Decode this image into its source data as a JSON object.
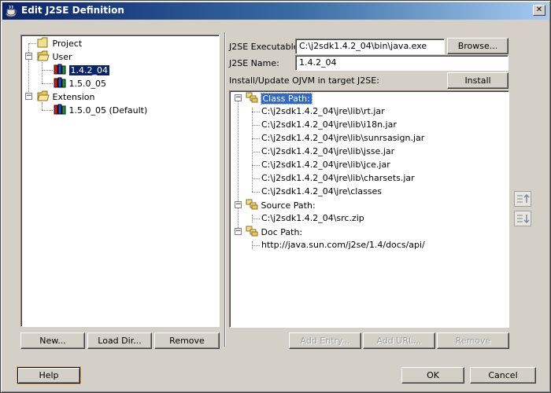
{
  "window": {
    "title": "Edit J2SE Definition",
    "close_glyph": "✕",
    "accent": "#0a246a"
  },
  "left_tree": {
    "nodes": [
      {
        "label": "Project",
        "icon": "folder-icon"
      },
      {
        "label": "User",
        "icon": "folder-open-icon"
      },
      {
        "label": "1.4.2_04",
        "icon": "library-icon",
        "selected": true
      },
      {
        "label": "1.5.0_05",
        "icon": "library-icon"
      },
      {
        "label": "Extension",
        "icon": "folder-open-icon"
      },
      {
        "label": "1.5.0_05 (Default)",
        "icon": "library-icon"
      }
    ]
  },
  "left_buttons": {
    "new": "New...",
    "load_dir": "Load Dir...",
    "remove": "Remove"
  },
  "form": {
    "executable_label": "J2SE Executable:",
    "executable_value": "C:\\j2sdk1.4.2_04\\bin\\java.exe",
    "browse": "Browse...",
    "name_label": "J2SE Name:",
    "name_value": "1.4.2_04",
    "install_label": "Install/Update OJVM in target J2SE:",
    "install": "Install"
  },
  "paths_tree": {
    "class_path": {
      "label": "Class Path:",
      "entries": [
        "C:\\j2sdk1.4.2_04\\jre\\lib\\rt.jar",
        "C:\\j2sdk1.4.2_04\\jre\\lib\\i18n.jar",
        "C:\\j2sdk1.4.2_04\\jre\\lib\\sunrsasign.jar",
        "C:\\j2sdk1.4.2_04\\jre\\lib\\jsse.jar",
        "C:\\j2sdk1.4.2_04\\jre\\lib\\jce.jar",
        "C:\\j2sdk1.4.2_04\\jre\\lib\\charsets.jar",
        "C:\\j2sdk1.4.2_04\\jre\\classes"
      ]
    },
    "source_path": {
      "label": "Source Path:",
      "entries": [
        "C:\\j2sdk1.4.2_04\\src.zip"
      ]
    },
    "doc_path": {
      "label": "Doc Path:",
      "entries": [
        "http://java.sun.com/j2se/1.4/docs/api/"
      ]
    }
  },
  "right_buttons": {
    "add_entry": "Add Entry...",
    "add_url": "Add URL...",
    "remove": "Remove"
  },
  "move_buttons": {
    "up_icon": "move-up-icon",
    "down_icon": "move-down-icon"
  },
  "footer": {
    "help": "Help",
    "ok": "OK",
    "cancel": "Cancel"
  }
}
